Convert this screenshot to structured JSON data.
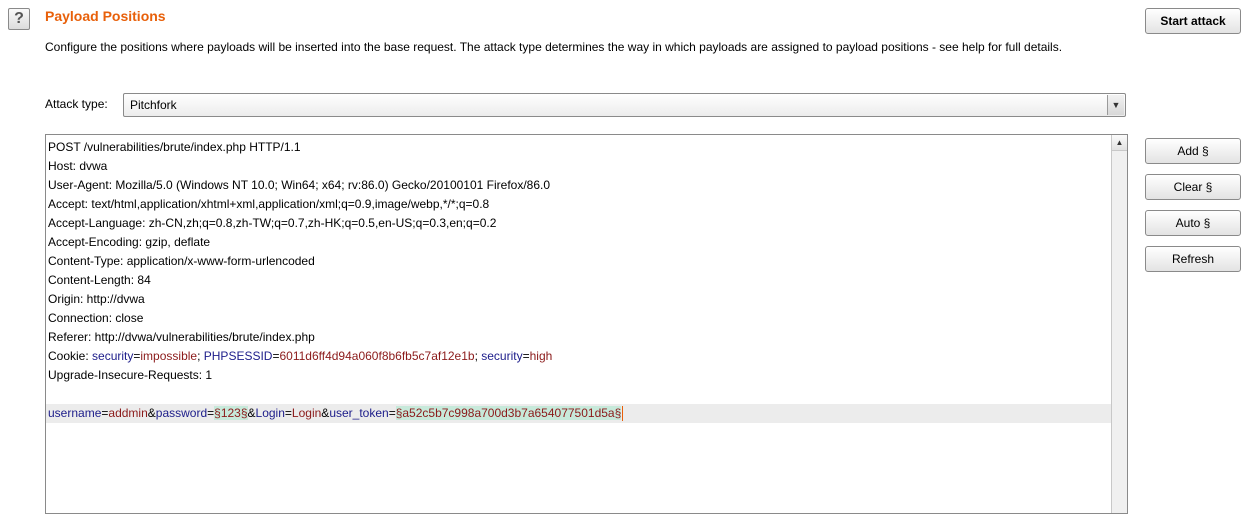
{
  "panel": {
    "help_label": "?",
    "title": "Payload Positions",
    "description": "Configure the positions where payloads will be inserted into the base request. The attack type determines the way in which payloads are assigned to payload positions - see help for full details."
  },
  "start_attack_label": "Start attack",
  "attack_type": {
    "label": "Attack type:",
    "value": "Pitchfork"
  },
  "side_buttons": {
    "add": "Add §",
    "clear": "Clear §",
    "auto": "Auto §",
    "refresh": "Refresh"
  },
  "request": {
    "lines": [
      "POST /vulnerabilities/brute/index.php HTTP/1.1",
      "Host: dvwa",
      "User-Agent: Mozilla/5.0 (Windows NT 10.0; Win64; x64; rv:86.0) Gecko/20100101 Firefox/86.0",
      "Accept: text/html,application/xhtml+xml,application/xml;q=0.9,image/webp,*/*;q=0.8",
      "Accept-Language: zh-CN,zh;q=0.8,zh-TW;q=0.7,zh-HK;q=0.5,en-US;q=0.3,en;q=0.2",
      "Accept-Encoding: gzip, deflate",
      "Content-Type: application/x-www-form-urlencoded",
      "Content-Length: 84",
      "Origin: http://dvwa",
      "Connection: close",
      "Referer: http://dvwa/vulnerabilities/brute/index.php"
    ],
    "cookie": {
      "prefix": "Cookie: ",
      "k1": "security",
      "eq1": "=",
      "v1": "impossible",
      "sep1": "; ",
      "k2": "PHPSESSID",
      "eq2": "=",
      "v2": "6011d6ff4d94a060f8b6fb5c7af12e1b",
      "sep2": "; ",
      "k3": "security",
      "eq3": "=",
      "v3": "high"
    },
    "upgrade": "Upgrade-Insecure-Requests: 1",
    "body": {
      "k1": "username",
      "eq1": "=",
      "v1": "addmin",
      "amp1": "&",
      "k2": "password",
      "eq2": "=",
      "p1": "§123§",
      "amp2": "&",
      "k3": "Login",
      "eq3": "=",
      "v3": "Login",
      "amp3": "&",
      "k4": "user_token",
      "eq4": "=",
      "p2": "§a52c5b7c998a700d3b7a654077501d5a§"
    }
  }
}
